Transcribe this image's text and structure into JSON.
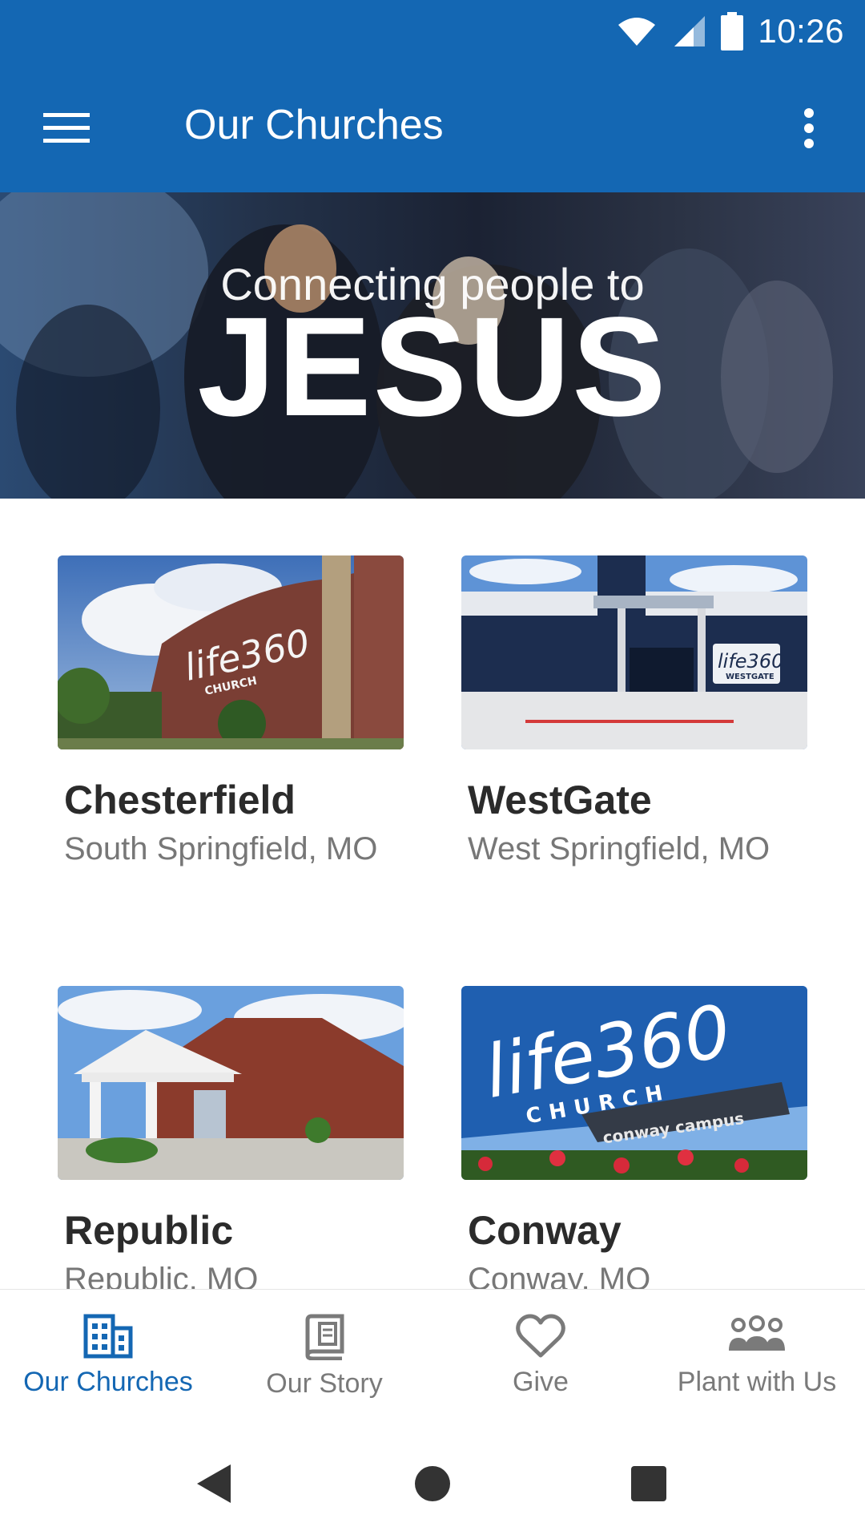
{
  "status_bar": {
    "time": "10:26",
    "icons": [
      "wifi-icon",
      "signal-icon",
      "battery-icon"
    ]
  },
  "app_bar": {
    "title": "Our Churches",
    "menu_icon": "hamburger-menu-icon",
    "overflow_icon": "more-vert-icon"
  },
  "hero": {
    "line1": "Connecting people to",
    "line2": "JESUS"
  },
  "churches": [
    {
      "name": "Chesterfield",
      "location": "South Springfield, MO"
    },
    {
      "name": "WestGate",
      "location": "West Springfield, MO"
    },
    {
      "name": "Republic",
      "location": "Republic, MO"
    },
    {
      "name": "Conway",
      "location": "Conway, MO"
    }
  ],
  "photo_text": {
    "chesterfield": [
      "life360",
      "CHURCH"
    ],
    "westgate": [
      "life360",
      "WESTGATE"
    ],
    "conway": [
      "life360",
      "CHURCH",
      "conway campus"
    ]
  },
  "bottom_nav": [
    {
      "label": "Our Churches",
      "icon": "building-icon",
      "active": true
    },
    {
      "label": "Our Story",
      "icon": "book-icon",
      "active": false
    },
    {
      "label": "Give",
      "icon": "heart-icon",
      "active": false
    },
    {
      "label": "Plant with Us",
      "icon": "people-group-icon",
      "active": false
    }
  ],
  "colors": {
    "primary": "#1467b3",
    "active_tab": "#1467b3",
    "inactive_tab": "#7a7a7a"
  }
}
